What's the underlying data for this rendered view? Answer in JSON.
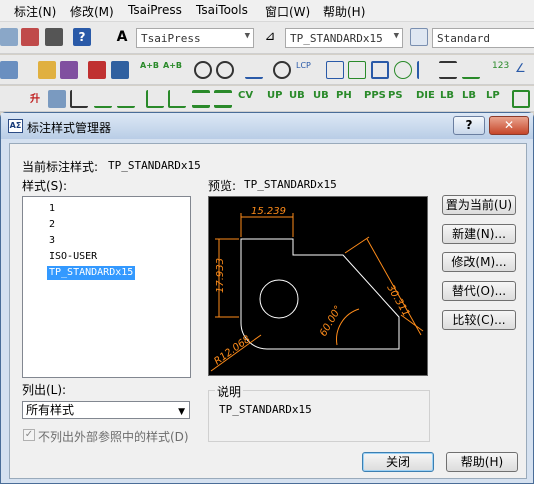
{
  "menubar": {
    "items": [
      "标注(N)",
      "修改(M)",
      "TsaiPress",
      "TsaiTools",
      "窗口(W)",
      "帮助(H)"
    ]
  },
  "toolbar1": {
    "textstyle_combo": "TsaiPress",
    "dimstyle_combo": "TP_STANDARDx15",
    "tablestyle_combo": "Standard"
  },
  "toolbar3": {
    "labels": [
      "升",
      "CV",
      "UP",
      "UB",
      "UB",
      "PH",
      "PPS",
      "PS",
      "DIE",
      "LB",
      "LB",
      "LP"
    ]
  },
  "dialog": {
    "title": "标注样式管理器",
    "help_button": "?",
    "close_x": "✕",
    "current_style_label": "当前标注样式:",
    "current_style_value": "TP_STANDARDx15",
    "styles_label": "样式(S):",
    "styles": [
      "1",
      "2",
      "3",
      "ISO-USER",
      "TP_STANDARDx15"
    ],
    "selected_style": "TP_STANDARDx15",
    "preview_label": "预览:",
    "preview_value": "TP_STANDARDx15",
    "buttons": {
      "set_current": "置为当前(U)",
      "new": "新建(N)...",
      "modify": "修改(M)...",
      "override": "替代(O)...",
      "compare": "比较(C)..."
    },
    "list_label": "列出(L):",
    "list_value": "所有样式",
    "checkbox_label": "不列出外部参照中的样式(D)",
    "description_label": "说明",
    "description_value": "TP_STANDARDx15",
    "close_button": "关闭",
    "help_button_bottom": "帮助(H)"
  },
  "preview_dims": {
    "top": "15.239",
    "left": "17.933",
    "right": "30.311",
    "angle": "60.00°",
    "radius": "R12.068"
  },
  "colors": {
    "dim_text": "#ff8c1a",
    "geometry": "#ffffff",
    "preview_bg": "#000000",
    "selection": "#3399ff"
  }
}
